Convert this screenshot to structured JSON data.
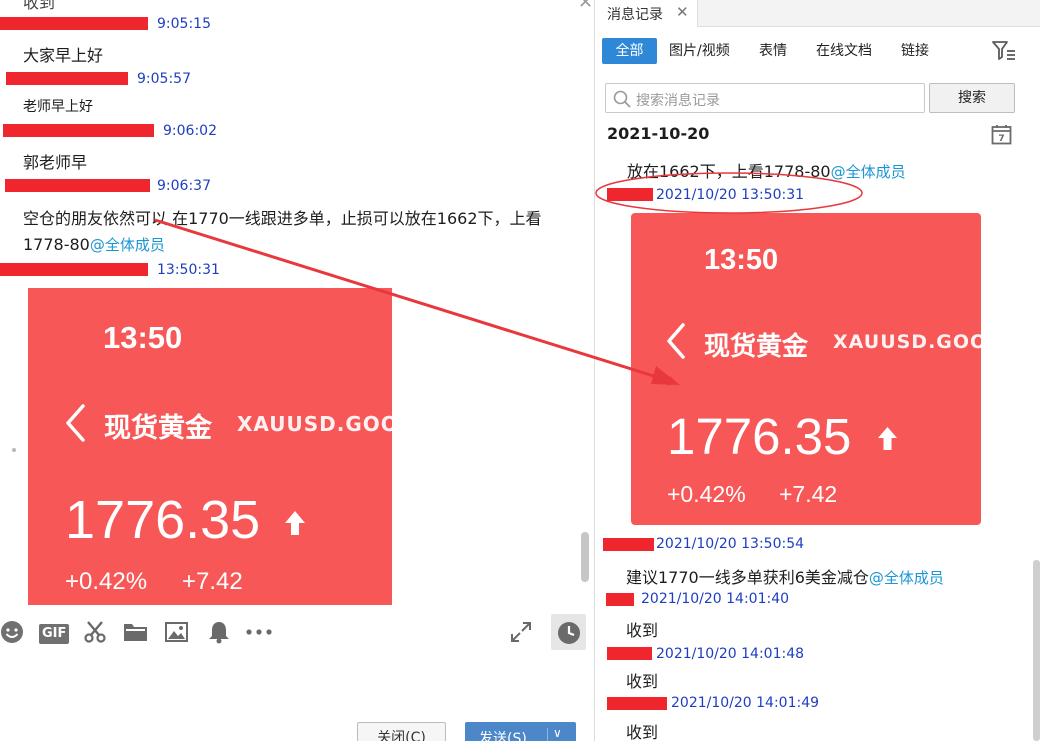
{
  "chat": {
    "messages": [
      {
        "time": "9:05:15",
        "text": "大家早上好"
      },
      {
        "time": "9:05:57",
        "text": "老师早上好"
      },
      {
        "time": "9:06:02",
        "text": "郭老师早"
      },
      {
        "time": "9:06:37",
        "text_line1": "空仓的朋友依然可以 在1770一线跟进多单，止损可以放在1662下，上看",
        "text_line2": "1778-80",
        "mention": "@全体成员"
      },
      {
        "time": "13:50:31"
      }
    ],
    "top_partial": "收到"
  },
  "card": {
    "time": "13:50",
    "name": "现货黄金",
    "symbol": "XAUUSD.GOOD",
    "price": "1776.35",
    "change_pct": "+0.42%",
    "change_abs": "+7.42"
  },
  "toolbar": {
    "icons": [
      "emoji-icon",
      "gif-icon",
      "scissors-icon",
      "folder-icon",
      "image-icon",
      "bell-icon",
      "more-icon",
      "expand-icon",
      "clock-icon"
    ],
    "gif_label": "GIF"
  },
  "buttons": {
    "close": "关闭(C)",
    "send": "发送(S)"
  },
  "history": {
    "tab_title": "消息记录",
    "filters": [
      "全部",
      "图片/视频",
      "表情",
      "在线文档",
      "链接"
    ],
    "search_placeholder": "搜索消息记录",
    "search_button": "搜索",
    "date": "2021-10-20",
    "entries": [
      {
        "text": "放在1662下，上看1778-80",
        "mention": "@全体成员"
      },
      {
        "time": "2021/10/20 13:50:31"
      },
      {
        "time": "2021/10/20 13:50:54",
        "text": "建议1770一线多单获利6美金减仓",
        "mention": "@全体成员"
      },
      {
        "time": "2021/10/20 14:01:40",
        "text": "收到"
      },
      {
        "time": "2021/10/20 14:01:48",
        "text": "收到"
      },
      {
        "time": "2021/10/20 14:01:49",
        "text": "收到"
      }
    ]
  },
  "colors": {
    "card_bg": "#f85757",
    "time_blue": "#1e3ec2",
    "mention_blue": "#1a96d4",
    "redact_red": "#f0262e",
    "accent_blue": "#2f87d8",
    "annotation_red": "#e8383d"
  }
}
